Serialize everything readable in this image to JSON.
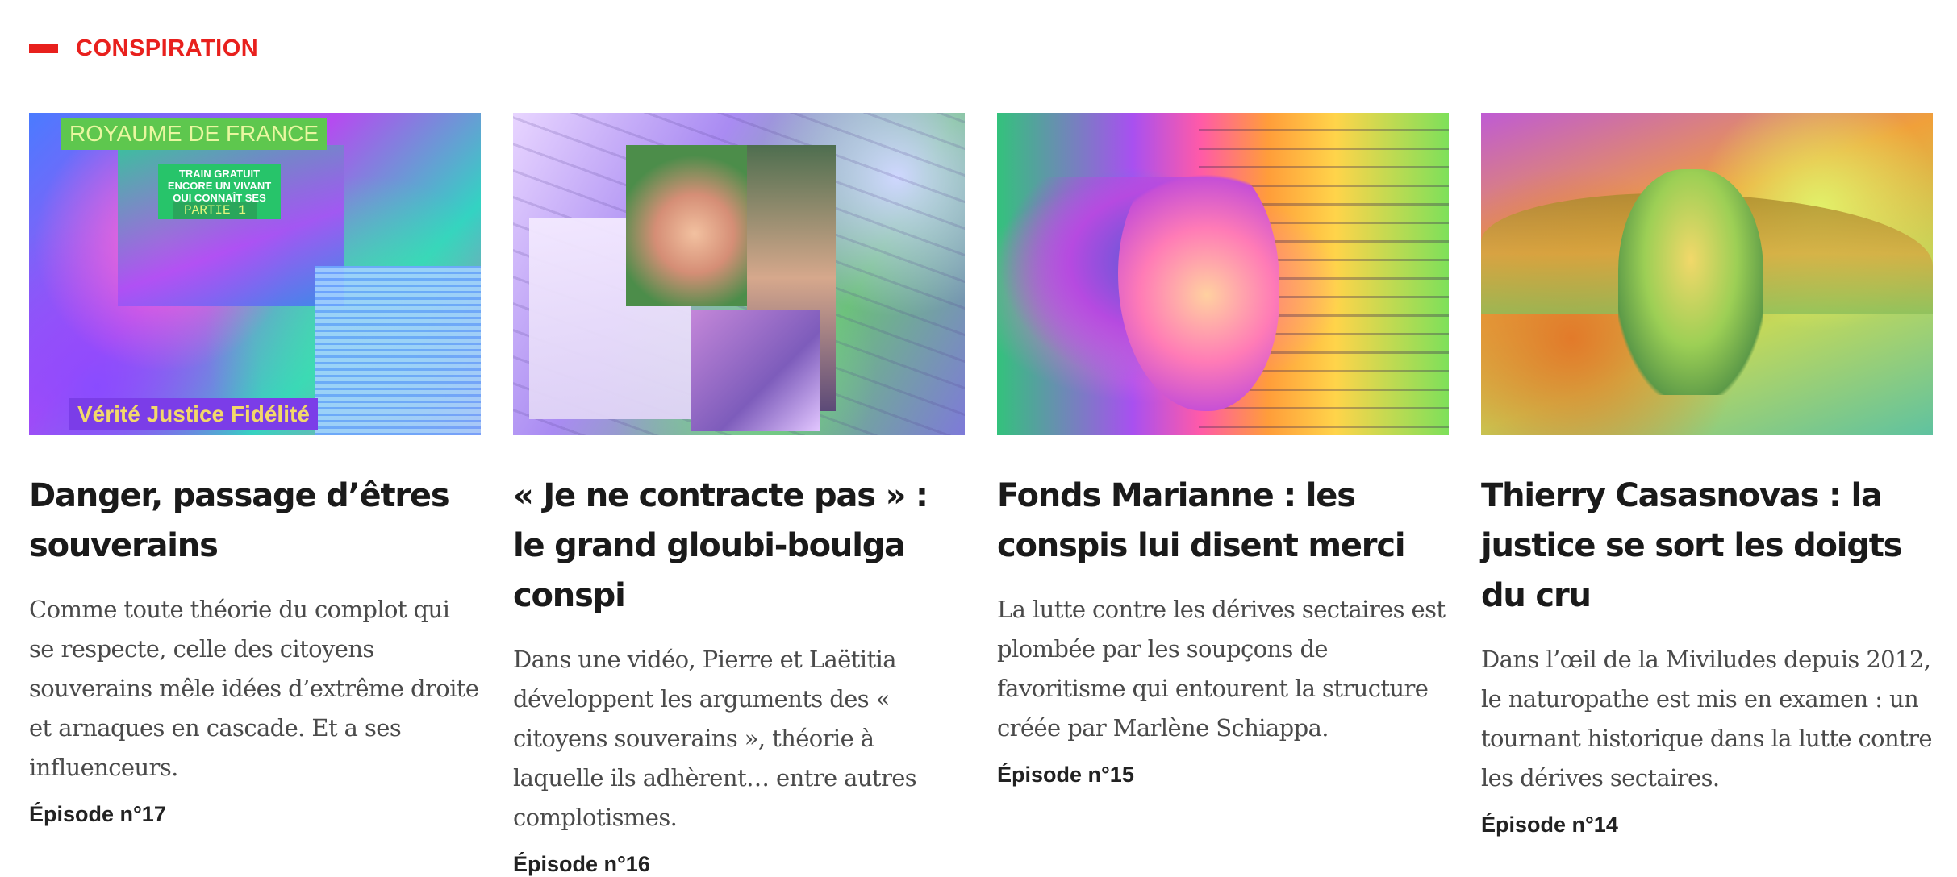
{
  "section": {
    "title": "CONSPIRATION",
    "accent_color": "#e8201d"
  },
  "articles": [
    {
      "image_overlay": {
        "top": "ROYAUME DE FRANCE",
        "mid": "TRAIN GRATUIT ENCORE UN VIVANT QUI CONNAÎT SES DROITS",
        "part": "PARTIE 1",
        "bottom": "Vérité  Justice  Fidélité"
      },
      "title": "Danger, passage d’êtres souverains",
      "description": "Comme toute théorie du complot qui se respecte, celle des citoyens souverains mêle idées d’extrême droite et arnaques en cascade. Et a ses influenceurs.",
      "episode": "Épisode n°17"
    },
    {
      "title": "« Je ne contracte pas » : le grand gloubi-boulga conspi",
      "description": "Dans une vidéo, Pierre et Laëtitia développent les arguments des « citoyens souverains », théorie à laquelle ils adhèrent… entre autres complotismes.",
      "episode": "Épisode n°16"
    },
    {
      "title": "Fonds Marianne : les conspis lui disent merci",
      "description": "La lutte contre les dérives sectaires est plombée par les soupçons de favoritisme qui entourent la structure créée par Marlène Schiappa.",
      "episode": "Épisode n°15"
    },
    {
      "title": "Thierry Casasnovas : la justice se sort les doigts du cru",
      "description": "Dans l’œil de la Miviludes depuis 2012, le naturopathe est mis en examen : un tournant historique dans la lutte contre les dérives sectaires.",
      "episode": "Épisode n°14"
    }
  ]
}
